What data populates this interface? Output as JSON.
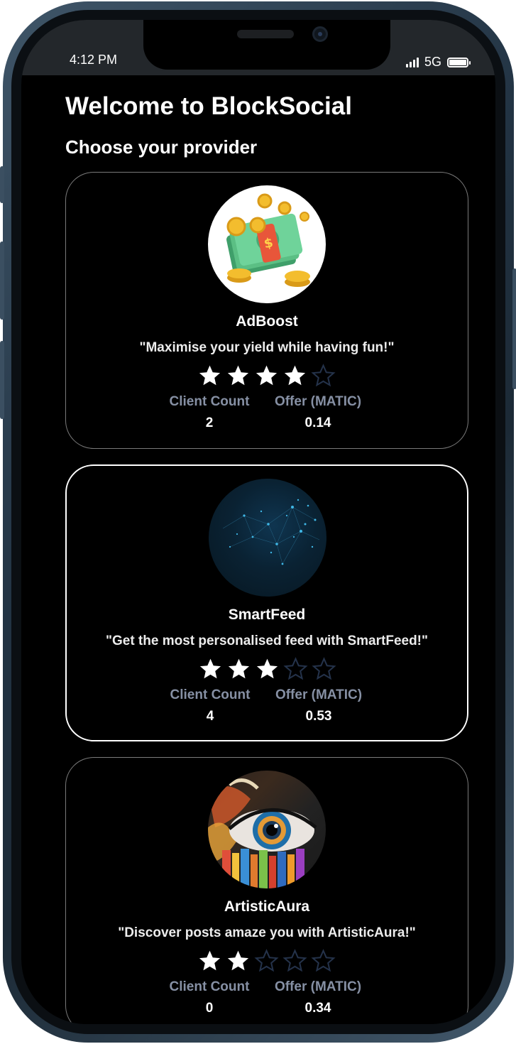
{
  "status_bar": {
    "time": "4:12 PM",
    "network": "5G",
    "icons": [
      "signal-bars-icon",
      "battery-icon"
    ]
  },
  "page": {
    "title": "Welcome to BlockSocial",
    "subtitle": "Choose your provider"
  },
  "stat_labels": {
    "client_count": "Client Count",
    "offer": "Offer (MATIC)"
  },
  "rating_max": 5,
  "colors": {
    "background": "#000000",
    "stat_label": "#8690a4",
    "star_filled": "#ffffff",
    "star_empty_outline": "#24324a",
    "card_border": "#7a7a7a",
    "card_border_selected": "#ffffff"
  },
  "providers": [
    {
      "name": "AdBoost",
      "tagline": "\"Maximise your yield while having fun!\"",
      "rating": 4,
      "client_count": "2",
      "offer": "0.14",
      "avatar": "money-coins-illustration",
      "selected": false
    },
    {
      "name": "SmartFeed",
      "tagline": "\"Get the most personalised feed with SmartFeed!\"",
      "rating": 3,
      "client_count": "4",
      "offer": "0.53",
      "avatar": "network-globe-image",
      "selected": true
    },
    {
      "name": "ArtisticAura",
      "tagline": "\"Discover posts amaze you with ArtisticAura!\"",
      "rating": 2,
      "client_count": "0",
      "offer": "0.34",
      "avatar": "painted-eye-image",
      "selected": false
    }
  ]
}
